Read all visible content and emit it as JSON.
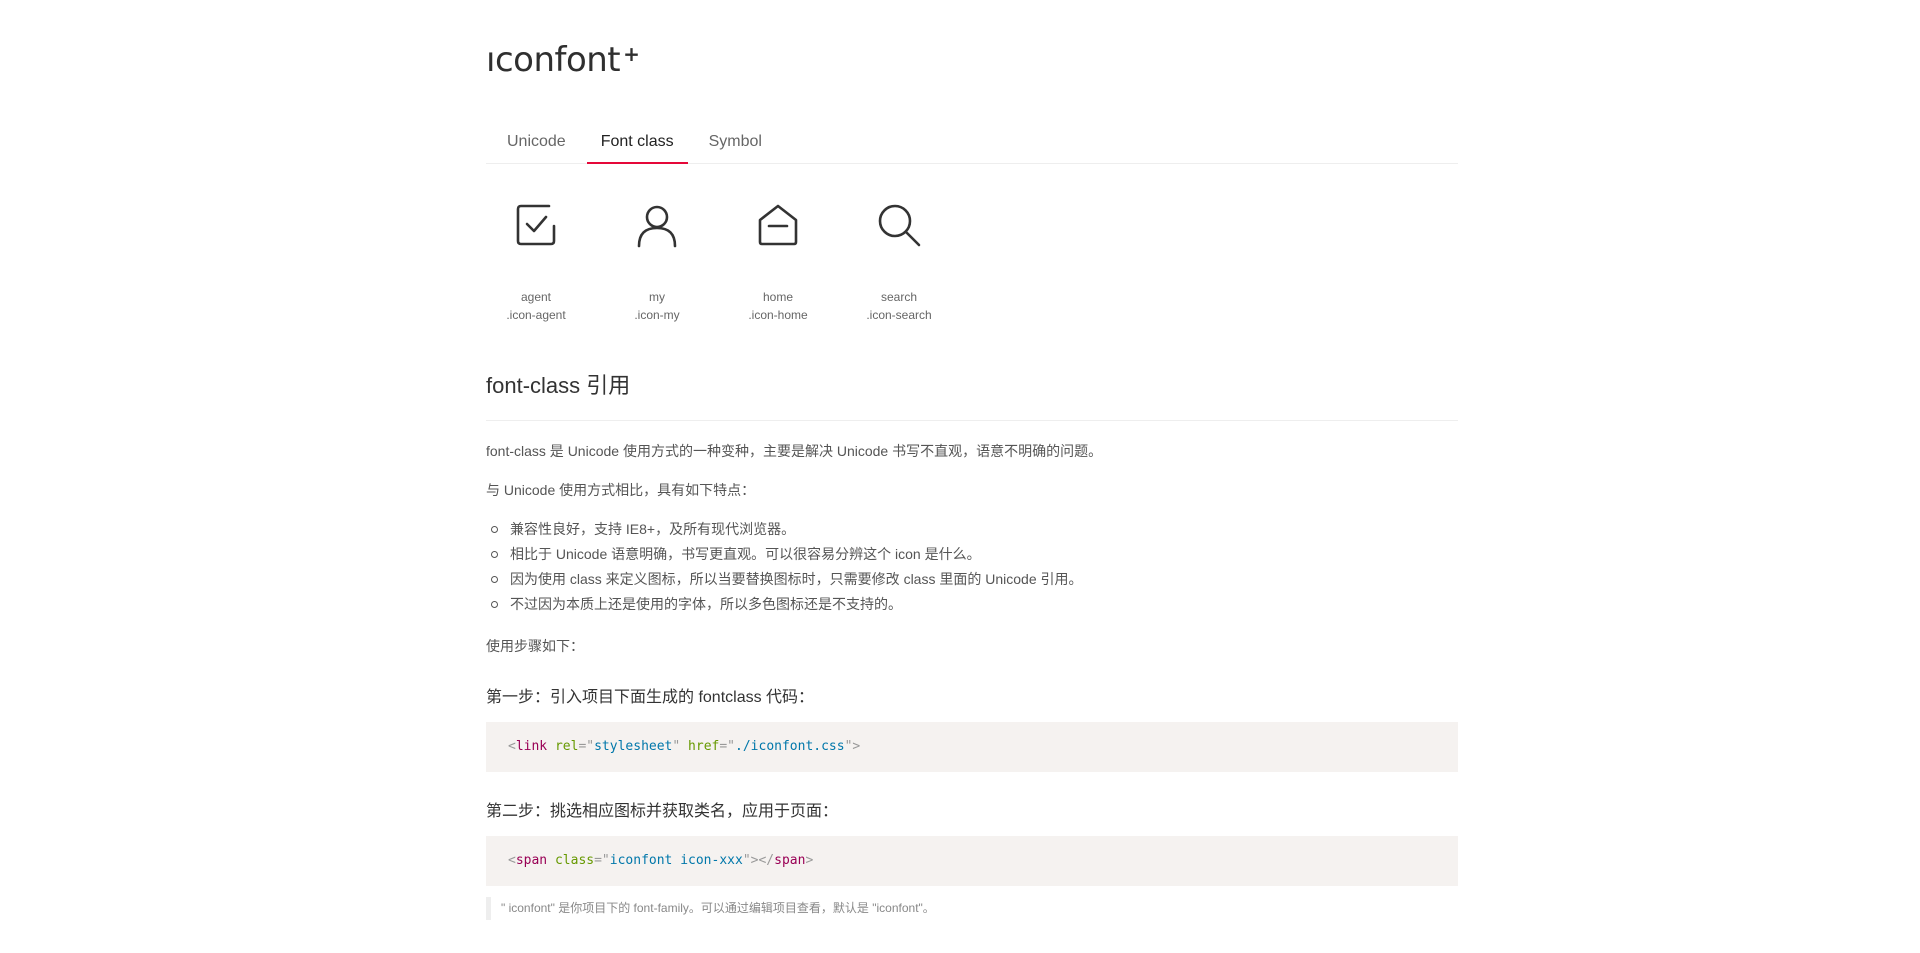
{
  "logo": {
    "text": "ıconfont",
    "plus": "+"
  },
  "tabs": [
    {
      "label": "Unicode",
      "active": false
    },
    {
      "label": "Font class",
      "active": true
    },
    {
      "label": "Symbol",
      "active": false
    }
  ],
  "colors": {
    "accent": "#e50839",
    "code_bg": "#f5f2f0"
  },
  "icons": [
    {
      "name": "agent",
      "code": ".icon-agent",
      "icon": "checkbox-icon"
    },
    {
      "name": "my",
      "code": ".icon-my",
      "icon": "user-icon"
    },
    {
      "name": "home",
      "code": ".icon-home",
      "icon": "home-icon"
    },
    {
      "name": "search",
      "code": ".icon-search",
      "icon": "search-icon"
    }
  ],
  "section": {
    "title": "font-class 引用",
    "intro": "font-class 是 Unicode 使用方式的一种变种，主要是解决 Unicode 书写不直观，语意不明确的问题。",
    "compare": "与 Unicode 使用方式相比，具有如下特点：",
    "bullets": [
      "兼容性良好，支持 IE8+，及所有现代浏览器。",
      "相比于 Unicode 语意明确，书写更直观。可以很容易分辨这个 icon 是什么。",
      "因为使用 class 来定义图标，所以当要替换图标时，只需要修改 class 里面的 Unicode 引用。",
      "不过因为本质上还是使用的字体，所以多色图标还是不支持的。"
    ],
    "steps_intro": "使用步骤如下：",
    "step1": "第一步：引入项目下面生成的 fontclass 代码：",
    "step1_code": {
      "open": "<",
      "tag": "link",
      "attr1": "rel",
      "eq1": "=\"",
      "val1": "stylesheet",
      "q1": "\"",
      "attr2": "href",
      "eq2": "=\"",
      "val2": "./iconfont.css",
      "close": "\">"
    },
    "step2": "第二步：挑选相应图标并获取类名，应用于页面：",
    "step2_code": {
      "open": "<",
      "tag": "span",
      "attr": "class",
      "eq": "=\"",
      "val": "iconfont icon-xxx",
      "mid": "\"></",
      "tag_close": "span",
      "end": ">"
    },
    "note": "\" iconfont\" 是你项目下的 font-family。可以通过编辑项目查看，默认是 \"iconfont\"。"
  }
}
